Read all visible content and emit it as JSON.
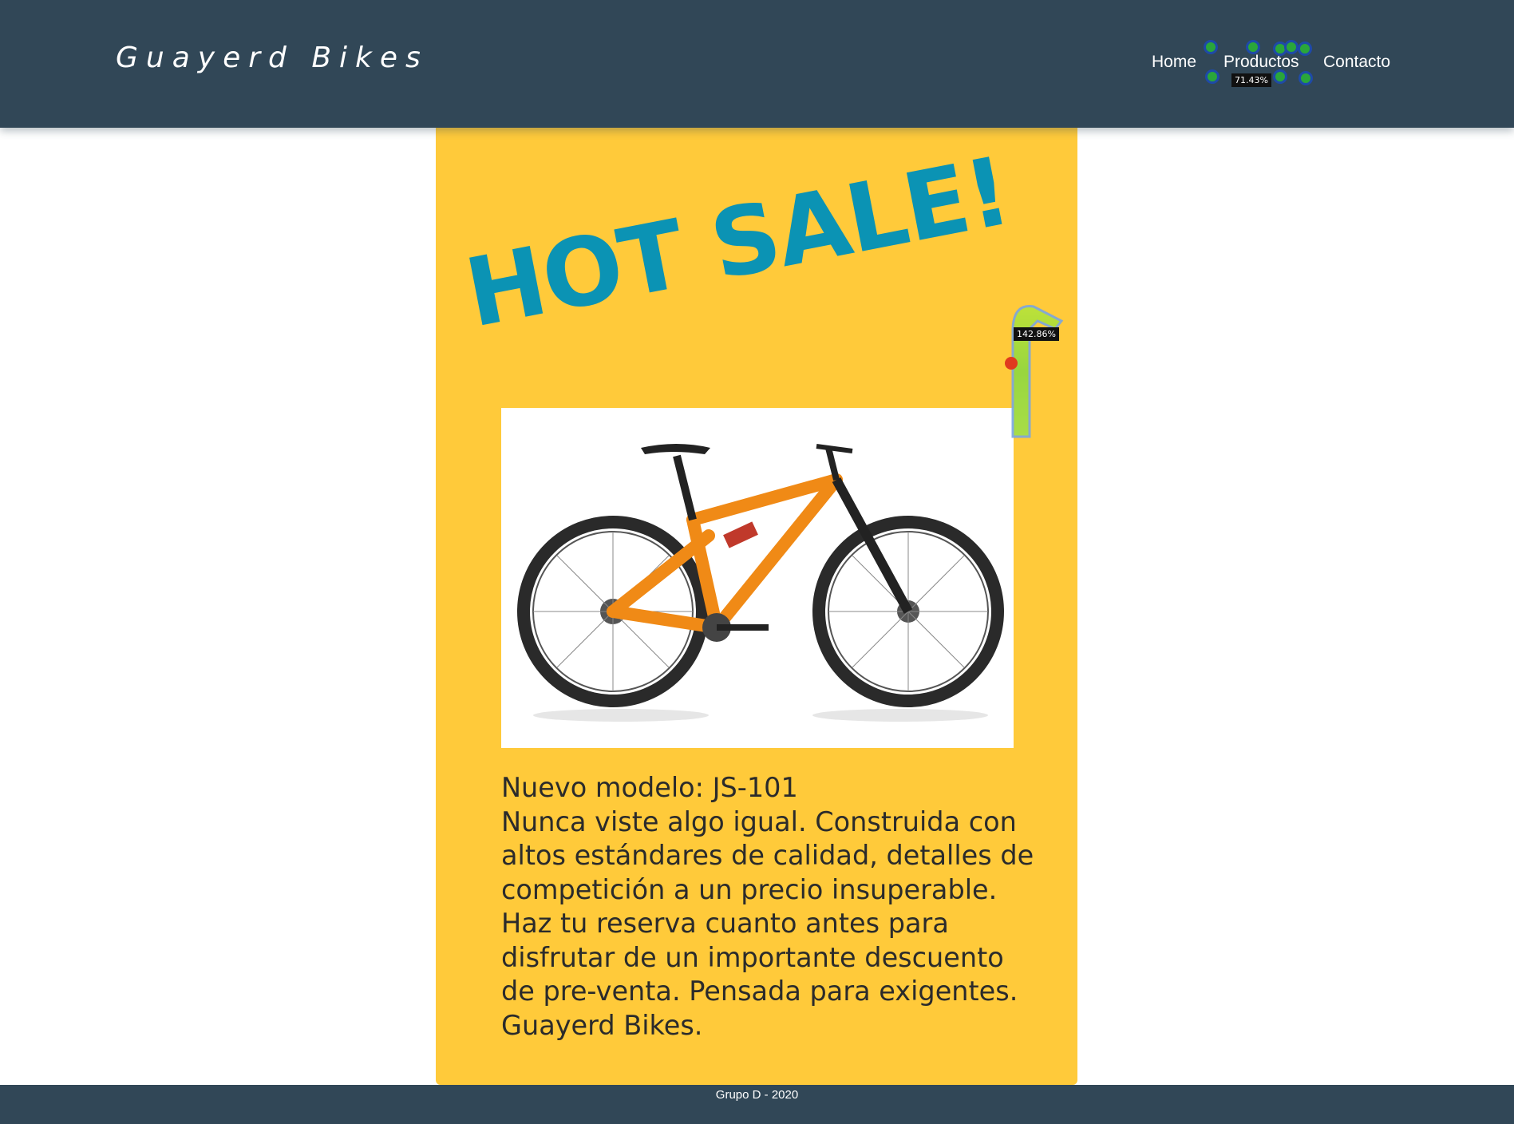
{
  "header": {
    "brand": "Guayerd Bikes",
    "nav": {
      "home": "Home",
      "productos": "Productos",
      "contacto": "Contacto"
    },
    "nav_click_percent": "71.43%"
  },
  "promo": {
    "headline": "HOT SALE!",
    "image_icon": "bicycle-image",
    "model": "Nuevo modelo: JS-101",
    "description": "Nunca viste algo igual. Construida con altos estándares de calidad, detalles de competición a un precio insuperable. Haz tu reserva cuanto antes para disfrutar de un importante descuento de pre-venta. Pensada para exigentes. Guayerd Bikes.",
    "heatmap_percent": "142.86%"
  },
  "footer": {
    "text": "Grupo D - 2020"
  },
  "colors": {
    "header_bg": "#314757",
    "card_bg": "#ffca3a",
    "headline": "#0b93b4"
  }
}
